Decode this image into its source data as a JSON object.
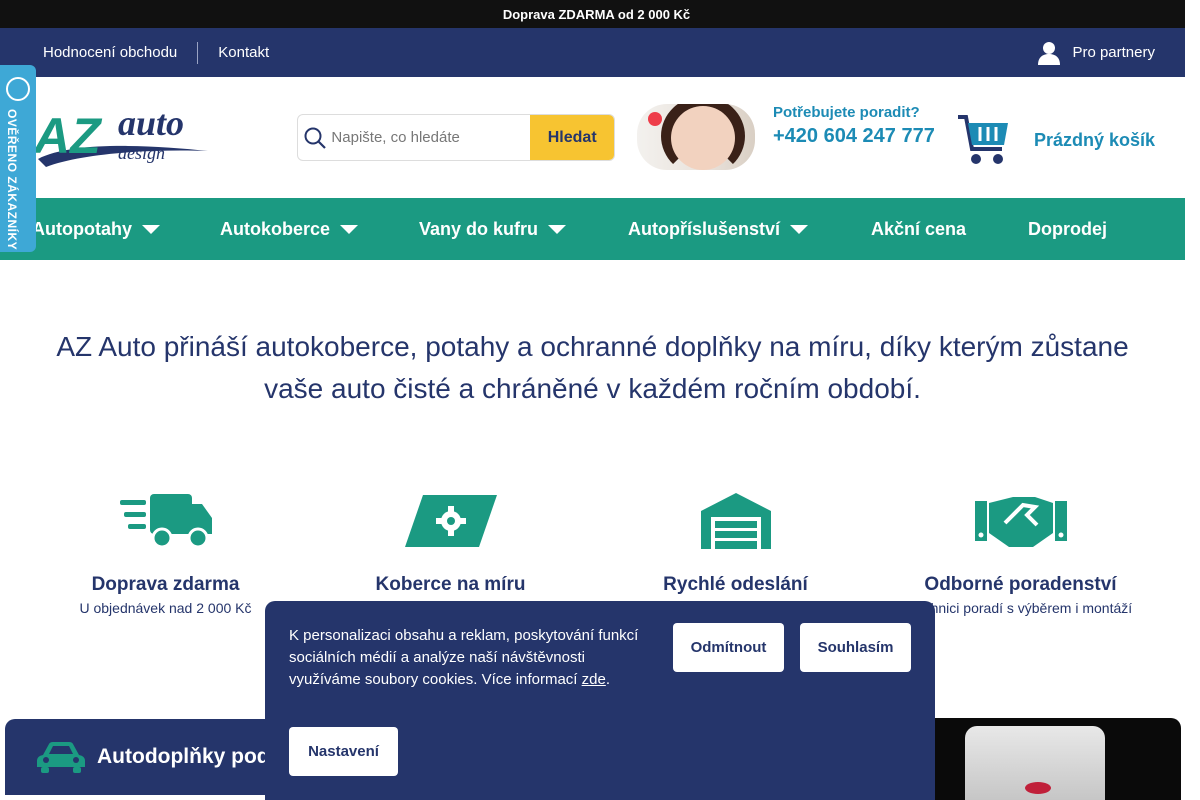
{
  "topbar": {
    "glyph": "",
    "text": "Doprava ZDARMA od 2 000 Kč"
  },
  "subnav": {
    "links": [
      "Hodnocení obchodu",
      "Kontakt"
    ],
    "partner_label": "Pro partnery"
  },
  "verified_badge": {
    "text": "OVĚŘENO ZÁKAZNÍKY"
  },
  "logo": {
    "brand": "AZ",
    "auto": "auto",
    "design": "design"
  },
  "search": {
    "placeholder": "Napište, co hledáte",
    "button": "Hledat"
  },
  "advisor": {
    "question": "Potřebujete poradit?",
    "phone": "+420 604 247 777"
  },
  "cart": {
    "label": "Prázdný košík"
  },
  "mainnav": [
    {
      "label": "Autopotahy",
      "dropdown": true
    },
    {
      "label": "Autokoberce",
      "dropdown": true
    },
    {
      "label": "Vany do kufru",
      "dropdown": true
    },
    {
      "label": "Autopříslušenství",
      "dropdown": true
    },
    {
      "label": "Akční cena",
      "dropdown": false
    },
    {
      "label": "Doprodej",
      "dropdown": false
    }
  ],
  "hero": {
    "text": "AZ Auto přináší autokoberce, potahy a ochranné doplňky na míru, díky kterým zůstane vaše auto čisté a chráněné v každém ročním období."
  },
  "features": [
    {
      "icon": "truck-icon",
      "title": "Doprava zdarma",
      "desc": "U objednávek nad 2 000 Kč"
    },
    {
      "icon": "ticket-gear-icon",
      "title": "Koberce na míru",
      "desc": ""
    },
    {
      "icon": "warehouse-icon",
      "title": "Rychlé odeslání",
      "desc": ""
    },
    {
      "icon": "handshake-icon",
      "title": "Odborné poradenství",
      "desc": "Technici poradí s výběrem i montáží"
    }
  ],
  "banner": {
    "title": "Autodoplňky pod"
  },
  "cookie": {
    "text": "K personalizaci obsahu a reklam, poskytování funkcí sociálních médií a analýze naší návštěvnosti využíváme soubory cookies. Více informací",
    "link": "zde",
    "trail": ".",
    "decline": "Odmítnout",
    "accept": "Souhlasím",
    "settings": "Nastavení"
  },
  "colors": {
    "navy": "#25356b",
    "green": "#1b9a82",
    "blue": "#1c8bb5",
    "yellow": "#f7c431",
    "badge": "#3ea8d6"
  }
}
